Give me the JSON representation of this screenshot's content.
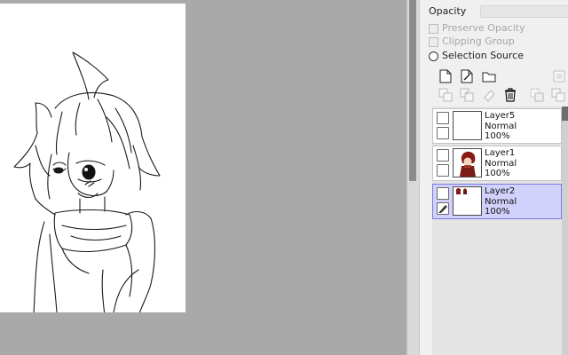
{
  "panel": {
    "opacity_label": "Opacity",
    "preserve_opacity": "Preserve Opacity",
    "clipping_group": "Clipping Group",
    "selection_source": "Selection Source"
  },
  "toolbar_icons": [
    "new-layer-icon",
    "new-linework-layer-icon",
    "new-folder-icon",
    "delete-layer-icon"
  ],
  "layers": [
    {
      "name": "Layer5",
      "mode": "Normal",
      "opacity": "100%",
      "selected": false
    },
    {
      "name": "Layer1",
      "mode": "Normal",
      "opacity": "100%",
      "selected": false
    },
    {
      "name": "Layer2",
      "mode": "Normal",
      "opacity": "100%",
      "selected": true
    }
  ],
  "colors": {
    "workspace": "#a9a9a9",
    "panel": "#f0f0f0",
    "selected_layer": "#d1d1fb",
    "selected_border": "#7a7ae0"
  }
}
